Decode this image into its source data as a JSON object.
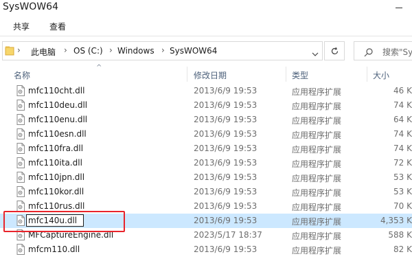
{
  "window": {
    "title": "SysWOW64"
  },
  "ribbon": {
    "tabs": [
      "共享",
      "查看"
    ]
  },
  "address_bar": {
    "crumbs": [
      "此电脑",
      "OS (C:)",
      "Windows",
      "SysWOW64"
    ]
  },
  "search": {
    "placeholder": "搜索\"Sy"
  },
  "columns": {
    "name": "名称",
    "modified": "修改日期",
    "type": "类型",
    "size": "大小"
  },
  "files": [
    {
      "name": "mfc110cht.dll",
      "modified": "2013/6/9 19:53",
      "type": "应用程序扩展",
      "size": "46 K"
    },
    {
      "name": "mfc110deu.dll",
      "modified": "2013/6/9 19:53",
      "type": "应用程序扩展",
      "size": "74 K"
    },
    {
      "name": "mfc110enu.dll",
      "modified": "2013/6/9 19:53",
      "type": "应用程序扩展",
      "size": "64 K"
    },
    {
      "name": "mfc110esn.dll",
      "modified": "2013/6/9 19:53",
      "type": "应用程序扩展",
      "size": "74 K"
    },
    {
      "name": "mfc110fra.dll",
      "modified": "2013/6/9 19:53",
      "type": "应用程序扩展",
      "size": "74 K"
    },
    {
      "name": "mfc110ita.dll",
      "modified": "2013/6/9 19:53",
      "type": "应用程序扩展",
      "size": "72 K"
    },
    {
      "name": "mfc110jpn.dll",
      "modified": "2013/6/9 19:53",
      "type": "应用程序扩展",
      "size": "53 K"
    },
    {
      "name": "mfc110kor.dll",
      "modified": "2013/6/9 19:53",
      "type": "应用程序扩展",
      "size": "53 K"
    },
    {
      "name": "mfc110rus.dll",
      "modified": "2013/6/9 19:53",
      "type": "应用程序扩展",
      "size": "70 K"
    },
    {
      "name": "mfc140u.dll",
      "modified": "2013/6/9 19:53",
      "type": "应用程序扩展",
      "size": "4,353 K",
      "selected": true,
      "renaming": true
    },
    {
      "name": "MFCaptureEngine.dll",
      "modified": "2023/5/17 18:37",
      "type": "应用程序扩展",
      "size": "588 K"
    },
    {
      "name": "mfcm110.dll",
      "modified": "2013/6/9 19:53",
      "type": "应用程序扩展",
      "size": "82 K"
    }
  ],
  "colors": {
    "selected_row": "#cce8ff",
    "highlight_frame": "#e8242b",
    "header_text": "#4c607a"
  }
}
